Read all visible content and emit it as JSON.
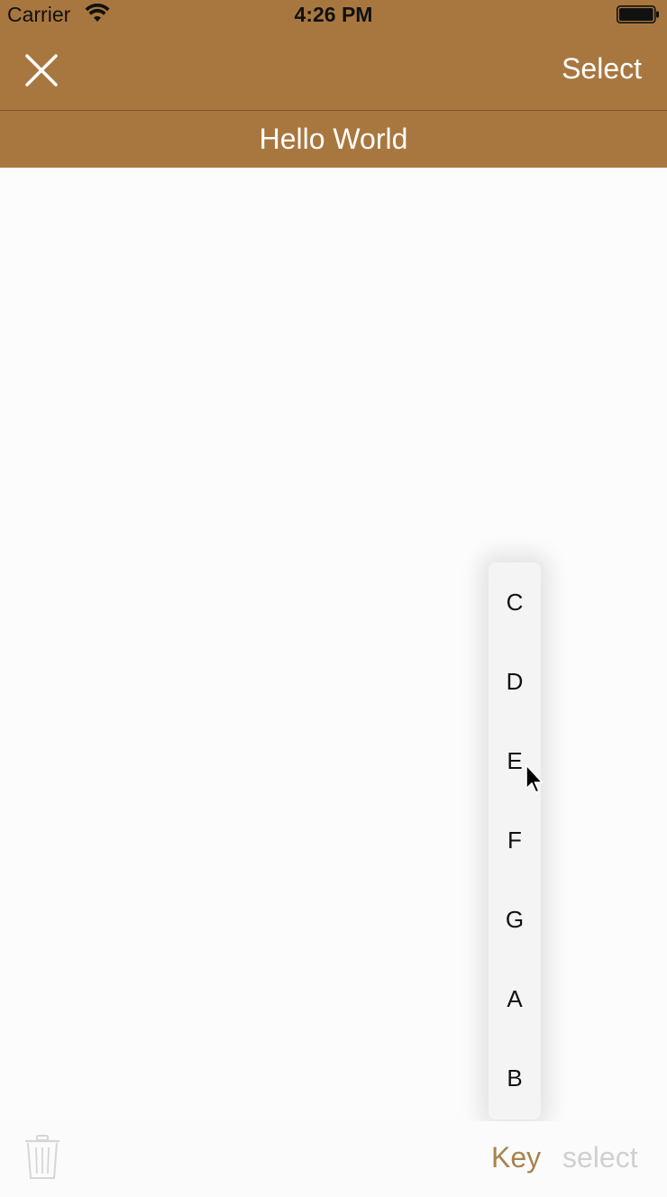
{
  "status_bar": {
    "carrier": "Carrier",
    "time": "4:26 PM",
    "wifi_icon": "wifi-icon",
    "battery_icon": "battery-icon"
  },
  "nav": {
    "close_icon": "close-icon",
    "select_label": "Select",
    "title": "Hello World"
  },
  "index_strip": {
    "items": [
      "C",
      "D",
      "E",
      "F",
      "G",
      "A",
      "B"
    ]
  },
  "toolbar": {
    "trash_icon": "trash-icon",
    "key_label": "Key",
    "select_label": "select"
  },
  "colors": {
    "accent": "#a8773f",
    "key_text": "#a8834f",
    "disabled_text": "#d0d0d0"
  }
}
